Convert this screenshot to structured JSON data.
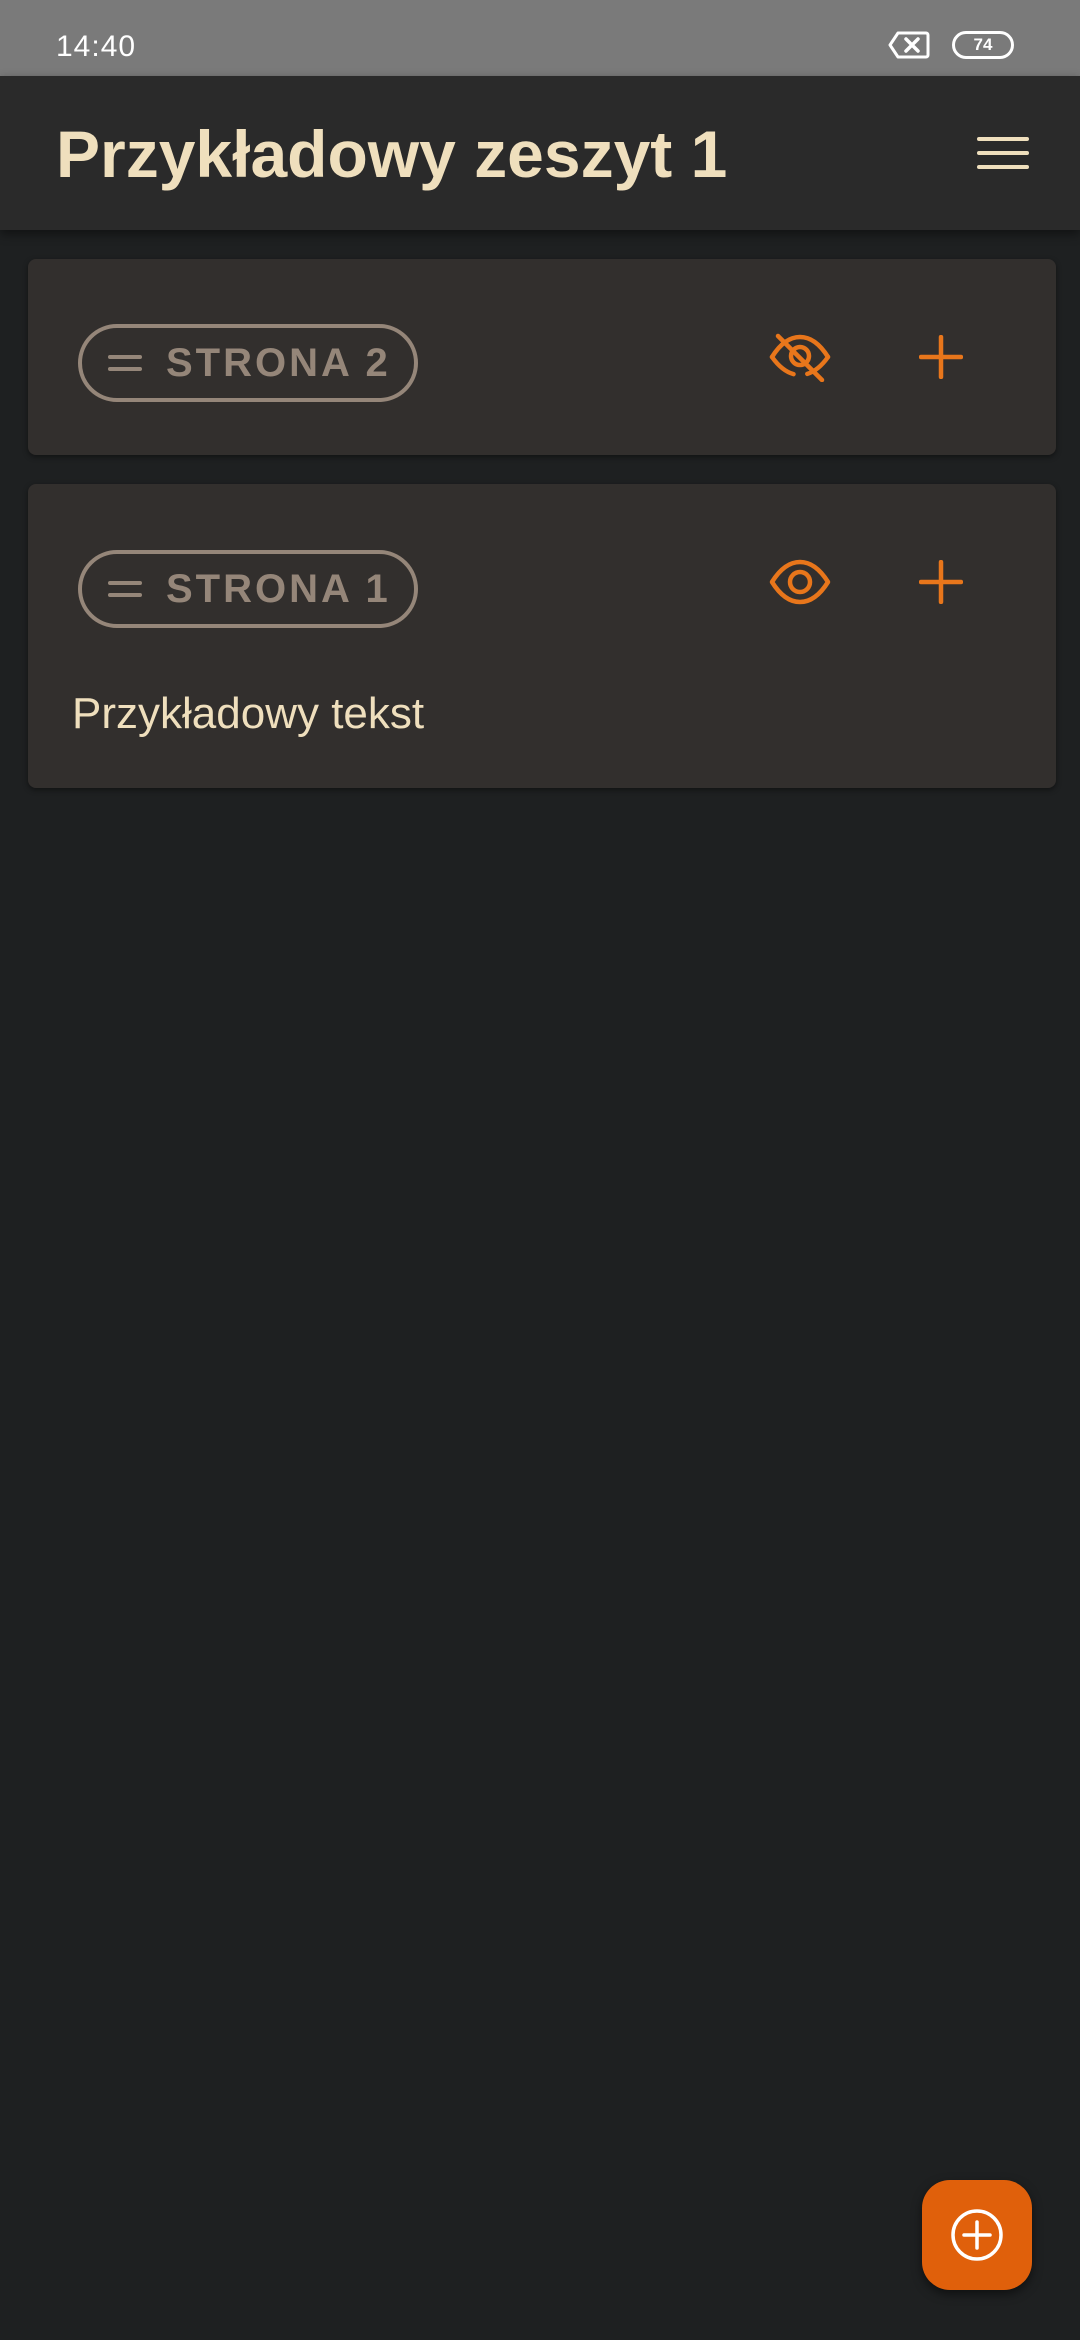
{
  "status_bar": {
    "time": "14:40",
    "battery": "74",
    "icons": [
      "no-sim-icon",
      "battery-icon"
    ]
  },
  "app_bar": {
    "title": "Przykładowy zeszyt 1",
    "menu_icon": "hamburger-menu-icon"
  },
  "pages": [
    {
      "label": "STRONA 2",
      "visibility_icon": "eye-off-icon",
      "add_icon": "plus-icon",
      "text": ""
    },
    {
      "label": "STRONA 1",
      "visibility_icon": "eye-icon",
      "add_icon": "plus-icon",
      "text": "Przykładowy tekst"
    }
  ],
  "fab": {
    "icon": "add-circle-icon"
  },
  "colors": {
    "accent": "#e8761b",
    "fab": "#e0600b",
    "title": "#efdfbd",
    "chip": "#958679",
    "card": "#322f2d",
    "background": "#1e2021",
    "app_bar": "#2a2a2a",
    "status_bar": "#7a7a7a"
  }
}
